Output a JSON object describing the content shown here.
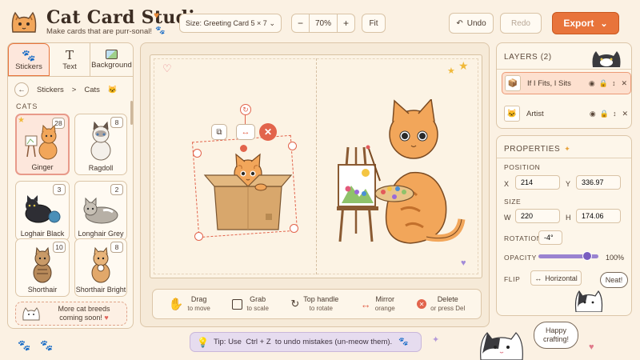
{
  "app": {
    "title": "Cat Card Studio",
    "tagline": "Make cards that are purr-sonal!",
    "logo_icon": "cat-logo-icon",
    "accent_color": "#e8743b"
  },
  "topbar": {
    "size_label": "Size: Greeting Card 5 × 7",
    "zoom_minus": "−",
    "zoom_value": "70%",
    "zoom_plus": "+",
    "fit_label": "Fit",
    "undo_label": "Undo",
    "redo_label": "Redo",
    "export_label": "Export"
  },
  "left_panel": {
    "tabs": [
      {
        "label": "Stickers",
        "icon": "paw-icon",
        "active": true
      },
      {
        "label": "Text",
        "icon": "text-icon",
        "active": false
      },
      {
        "label": "Background",
        "icon": "image-icon",
        "active": false
      }
    ],
    "breadcrumb": {
      "root": "Stickers",
      "separator": ">",
      "current": "Cats"
    },
    "section": "CATS",
    "stickers": [
      {
        "name": "Ginger",
        "count": "28",
        "selected": true
      },
      {
        "name": "Ragdoll",
        "count": "8",
        "selected": false
      },
      {
        "name": "Loghair Black",
        "count": "3",
        "selected": false
      },
      {
        "name": "Longhair Grey",
        "count": "2",
        "selected": false
      },
      {
        "name": "Shorthair",
        "count": "10",
        "selected": false
      },
      {
        "name": "Shorthair Bright",
        "count": "8",
        "selected": false
      }
    ],
    "promo_line1": "More cat breeds",
    "promo_line2": "coming soon!"
  },
  "canvas": {
    "sticker_box_name": "If I Fits, I Sits",
    "sticker_artist_name": "Artist"
  },
  "hints": [
    {
      "title": "Drag",
      "sub": "to move",
      "icon": "hand-icon"
    },
    {
      "title": "Grab",
      "sub": "to scale",
      "icon": "scale-icon"
    },
    {
      "title": "Top handle",
      "sub": "to rotate",
      "icon": "rotate-icon"
    },
    {
      "title": "Mirror",
      "sub": "orange",
      "icon": "mirror-icon"
    },
    {
      "title": "Delete",
      "sub": "or press Del",
      "icon": "delete-icon"
    }
  ],
  "tip": "Tip: Use  Ctrl + Z  to undo mistakes (un-meow them).",
  "layers": {
    "title": "LAYERS (2)",
    "items": [
      {
        "name": "If I Fits, I Sits",
        "selected": true
      },
      {
        "name": "Artist",
        "selected": false
      }
    ]
  },
  "properties": {
    "title": "PROPERTIES",
    "position_label": "POSITION",
    "x_label": "X",
    "x_value": "214",
    "y_label": "Y",
    "y_value": "336.97",
    "size_label": "SIZE",
    "w_label": "W",
    "w_value": "220",
    "h_label": "H",
    "h_value": "174.06",
    "rotation_label": "ROTATION",
    "rotation_value": "-4°",
    "opacity_label": "OPACITY",
    "opacity_value": "100%",
    "opacity_fraction": 1.0,
    "flip_label": "FLIP",
    "flip_value": "Horizontal"
  },
  "bubbles": {
    "neat": "Neat!",
    "happy_line1": "Happy",
    "happy_line2": "crafting!"
  }
}
